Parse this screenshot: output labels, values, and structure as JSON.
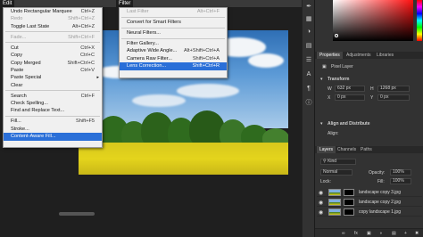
{
  "menubar": {
    "edit_title": "Edit",
    "filter_title": "Filter"
  },
  "edit_menu": {
    "items": [
      {
        "label": "Undo Rectangular Marquee",
        "shortcut": "Ctrl+Z",
        "disabled": false
      },
      {
        "label": "Redo",
        "shortcut": "Shift+Ctrl+Z",
        "disabled": true
      },
      {
        "label": "Toggle Last State",
        "shortcut": "Alt+Ctrl+Z",
        "disabled": false
      },
      {
        "label": "Fade...",
        "shortcut": "Shift+Ctrl+F",
        "disabled": true
      },
      {
        "label": "Cut",
        "shortcut": "Ctrl+X",
        "disabled": false
      },
      {
        "label": "Copy",
        "shortcut": "Ctrl+C",
        "disabled": false
      },
      {
        "label": "Copy Merged",
        "shortcut": "Shift+Ctrl+C",
        "disabled": false
      },
      {
        "label": "Paste",
        "shortcut": "Ctrl+V",
        "disabled": false
      },
      {
        "label": "Paste Special",
        "shortcut": "",
        "disabled": false
      },
      {
        "label": "Clear",
        "shortcut": "",
        "disabled": false
      },
      {
        "label": "Search",
        "shortcut": "Ctrl+F",
        "disabled": false
      },
      {
        "label": "Check Spelling...",
        "shortcut": "",
        "disabled": false
      },
      {
        "label": "Find and Replace Text...",
        "shortcut": "",
        "disabled": false
      },
      {
        "label": "Fill...",
        "shortcut": "Shift+F5",
        "disabled": false
      },
      {
        "label": "Stroke...",
        "shortcut": "",
        "disabled": false
      },
      {
        "label": "Content-Aware Fill...",
        "shortcut": "",
        "disabled": false,
        "highlighted": true
      }
    ]
  },
  "filter_menu": {
    "items": [
      {
        "label": "Last Filter",
        "shortcut": "Alt+Ctrl+F",
        "disabled": true
      },
      {
        "label": "Convert for Smart Filters",
        "shortcut": "",
        "disabled": false
      },
      {
        "label": "Neural Filters...",
        "shortcut": "",
        "disabled": false
      },
      {
        "label": "Filter Gallery...",
        "shortcut": "",
        "disabled": false
      },
      {
        "label": "Adaptive Wide Angle...",
        "shortcut": "Alt+Shift+Ctrl+A",
        "disabled": false
      },
      {
        "label": "Camera Raw Filter...",
        "shortcut": "Shift+Ctrl+A",
        "disabled": false
      },
      {
        "label": "Lens Correction...",
        "shortcut": "Shift+Ctrl+R",
        "disabled": false,
        "highlighted": true
      }
    ]
  },
  "properties_panel": {
    "tabs": [
      "Properties",
      "Adjustments",
      "Libraries"
    ],
    "layer_type": "Pixel Layer",
    "transform_title": "Transform",
    "w_label": "W",
    "w_value": "632 px",
    "h_label": "H",
    "h_value": "1268 px",
    "x_label": "X",
    "x_value": "0 px",
    "y_label": "Y",
    "y_value": "0 px",
    "align_title": "Align and Distribute",
    "align_sub": "Align:"
  },
  "layers_panel": {
    "tabs": [
      "Layers",
      "Channels",
      "Paths"
    ],
    "kind_label": "Kind",
    "blend_mode": "Normal",
    "opacity_label": "Opacity:",
    "opacity_value": "100%",
    "lock_label": "Lock:",
    "fill_label": "Fill:",
    "fill_value": "100%",
    "layers": [
      {
        "name": "landscape copy 3.jpg"
      },
      {
        "name": "landscape copy 2.jpg"
      },
      {
        "name": "copy landscape 1.jpg"
      }
    ]
  },
  "colors": {
    "menu_highlight": "#2a6fd8",
    "menu_bg": "#f0f0f0",
    "panel_bg": "#323232"
  }
}
